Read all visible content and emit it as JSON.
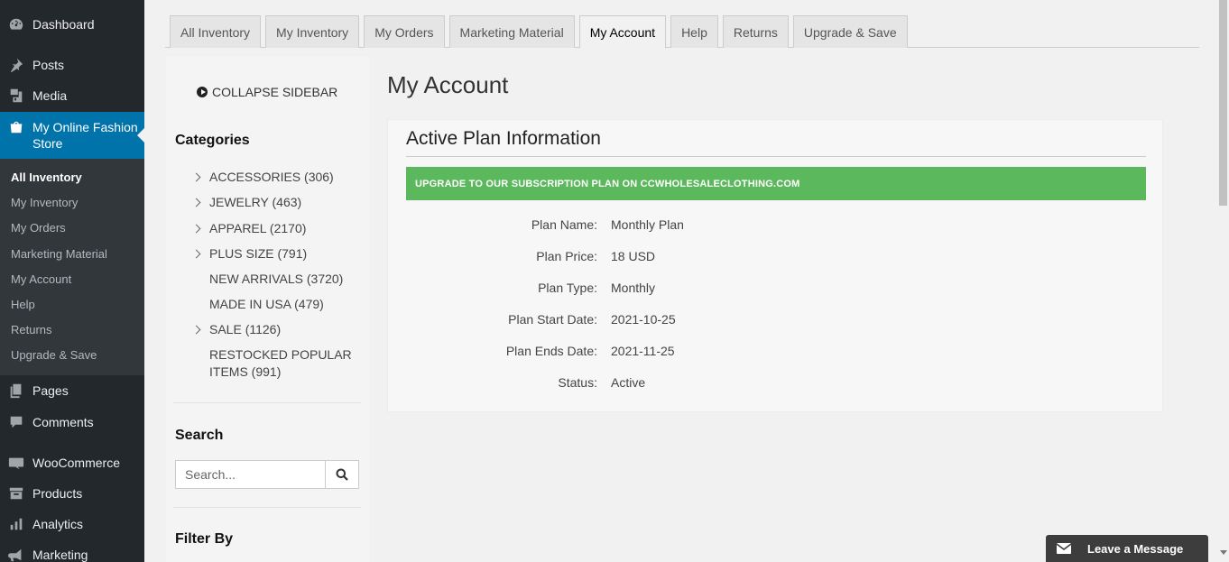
{
  "wp_menu": {
    "dashboard": "Dashboard",
    "posts": "Posts",
    "media": "Media",
    "store": "My Online Fashion Store",
    "submenu": [
      "All Inventory",
      "My Inventory",
      "My Orders",
      "Marketing Material",
      "My Account",
      "Help",
      "Returns",
      "Upgrade & Save"
    ],
    "pages": "Pages",
    "comments": "Comments",
    "woocommerce": "WooCommerce",
    "products": "Products",
    "analytics": "Analytics",
    "marketing": "Marketing"
  },
  "tabs": [
    "All Inventory",
    "My Inventory",
    "My Orders",
    "Marketing Material",
    "My Account",
    "Help",
    "Returns",
    "Upgrade & Save"
  ],
  "active_tab": "My Account",
  "panel": {
    "collapse": "COLLAPSE SIDEBAR",
    "categories_title": "Categories",
    "categories": [
      {
        "label": "ACCESSORIES (306)",
        "expandable": true
      },
      {
        "label": "JEWELRY (463)",
        "expandable": true
      },
      {
        "label": "APPAREL (2170)",
        "expandable": true
      },
      {
        "label": "PLUS SIZE (791)",
        "expandable": true
      },
      {
        "label": "NEW ARRIVALS (3720)",
        "expandable": false
      },
      {
        "label": "MADE IN USA (479)",
        "expandable": false
      },
      {
        "label": "SALE (1126)",
        "expandable": true
      },
      {
        "label": "RESTOCKED POPULAR ITEMS (991)",
        "expandable": false
      }
    ],
    "search_title": "Search",
    "search_placeholder": "Search...",
    "filter_title": "Filter By"
  },
  "main": {
    "title": "My Account",
    "card_title": "Active Plan Information",
    "banner": "UPGRADE TO OUR SUBSCRIPTION PLAN ON CCWHOLESALECLOTHING.COM",
    "plan": [
      {
        "label": "Plan Name:",
        "value": "Monthly Plan"
      },
      {
        "label": "Plan Price:",
        "value": "18 USD"
      },
      {
        "label": "Plan Type:",
        "value": "Monthly"
      },
      {
        "label": "Plan Start Date:",
        "value": "2021-10-25"
      },
      {
        "label": "Plan Ends Date:",
        "value": "2021-11-25"
      },
      {
        "label": "Status:",
        "value": "Active"
      }
    ]
  },
  "chat": {
    "label": "Leave a Message"
  },
  "colors": {
    "wp_sidebar": "#23282d",
    "wp_submenu": "#32373c",
    "wp_accent": "#0073aa",
    "banner": "#5cb85c"
  }
}
